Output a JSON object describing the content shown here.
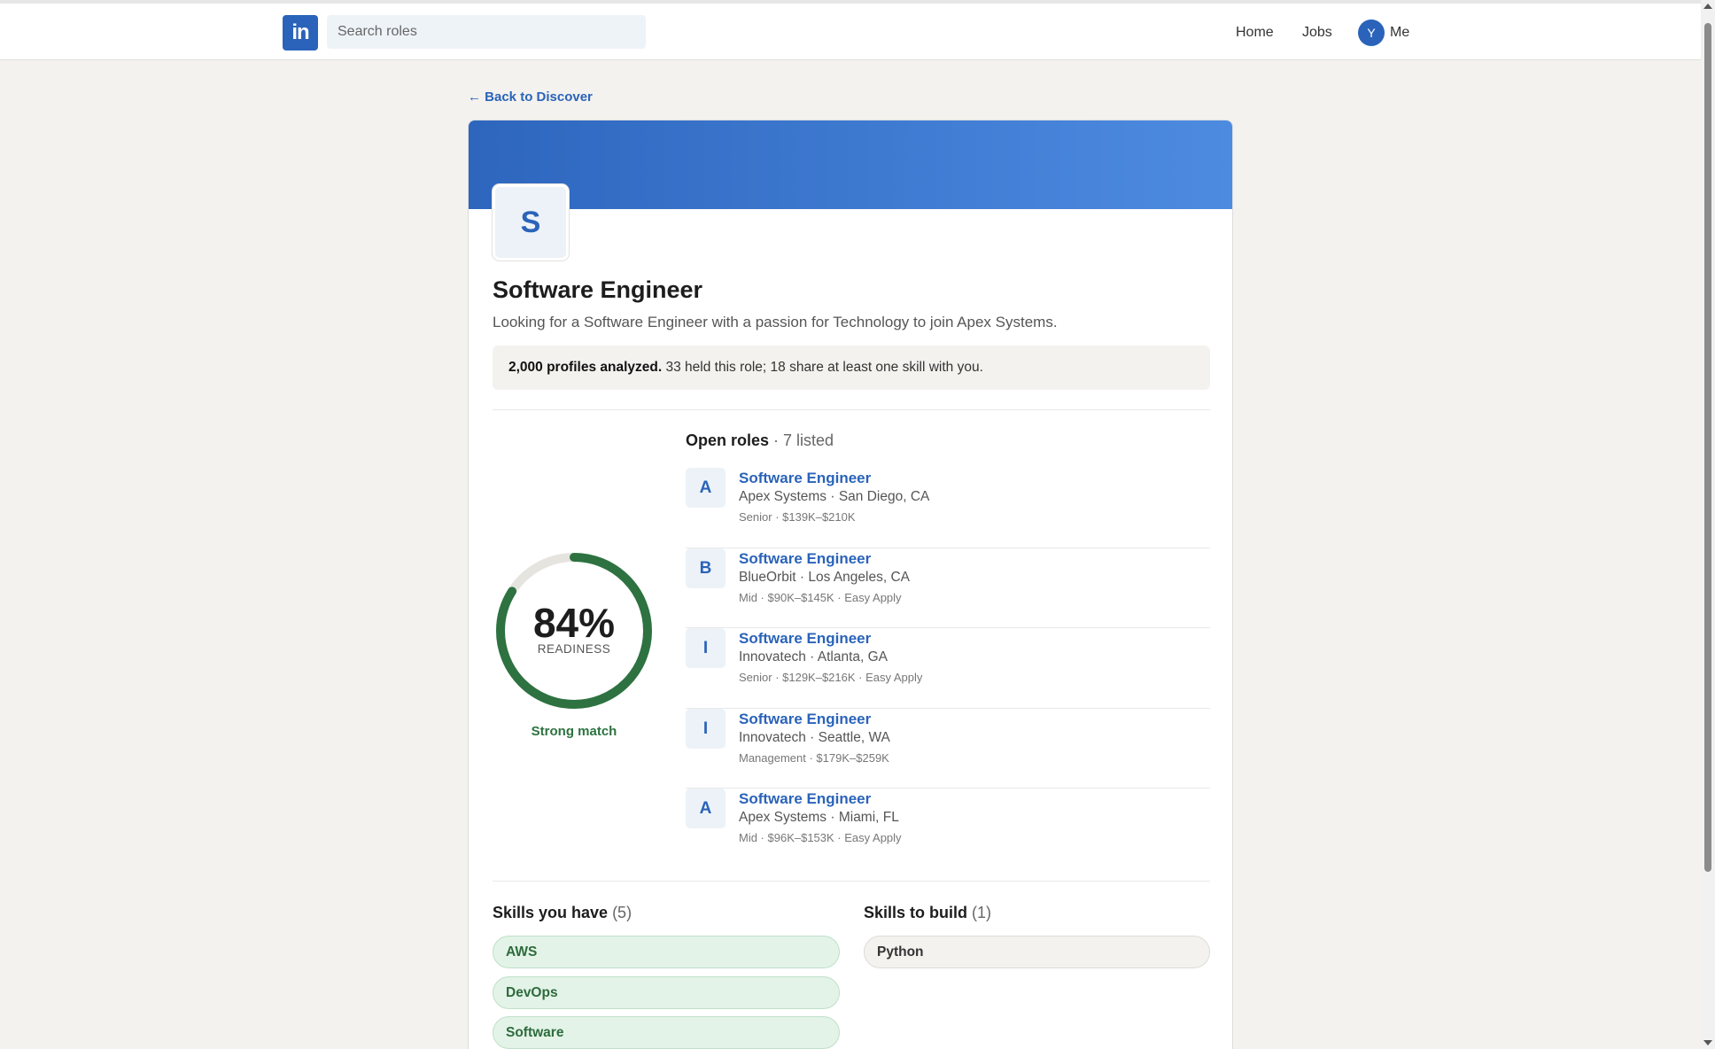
{
  "nav": {
    "logo": "in",
    "search_placeholder": "Search roles",
    "home": "Home",
    "jobs": "Jobs",
    "avatar_initial": "Y",
    "me": "Me"
  },
  "back_link": "← Back to Discover",
  "role": {
    "logo_letter": "S",
    "title": "Software Engineer",
    "description": "Looking for a Software Engineer with a passion for Technology to join Apex Systems.",
    "stats_bold": "2,000 profiles analyzed.",
    "stats_rest": " 33 held this role; 18 share at least one skill with you."
  },
  "readiness": {
    "percent": 84,
    "percent_label": "84%",
    "label": "READINESS",
    "match": "Strong match",
    "colors": {
      "progress": "#2d7240",
      "track": "#e6e4df"
    }
  },
  "open_roles": {
    "heading": "Open roles",
    "count": " · 7 listed",
    "items": [
      {
        "badge": "A",
        "title": "Software Engineer",
        "company": "Apex Systems · San Diego, CA",
        "meta": "Senior · $139K–$210K"
      },
      {
        "badge": "B",
        "title": "Software Engineer",
        "company": "BlueOrbit · Los Angeles, CA",
        "meta": "Mid · $90K–$145K · Easy Apply"
      },
      {
        "badge": "I",
        "title": "Software Engineer",
        "company": "Innovatech · Atlanta, GA",
        "meta": "Senior · $129K–$216K · Easy Apply"
      },
      {
        "badge": "I",
        "title": "Software Engineer",
        "company": "Innovatech · Seattle, WA",
        "meta": "Management · $179K–$259K"
      },
      {
        "badge": "A",
        "title": "Software Engineer",
        "company": "Apex Systems · Miami, FL",
        "meta": "Mid · $96K–$153K · Easy Apply"
      }
    ]
  },
  "skills_have": {
    "heading": "Skills you have",
    "count": " (5)",
    "items": [
      "AWS",
      "DevOps",
      "Software"
    ]
  },
  "skills_build": {
    "heading": "Skills to build",
    "count": " (1)",
    "items": [
      "Python"
    ]
  }
}
